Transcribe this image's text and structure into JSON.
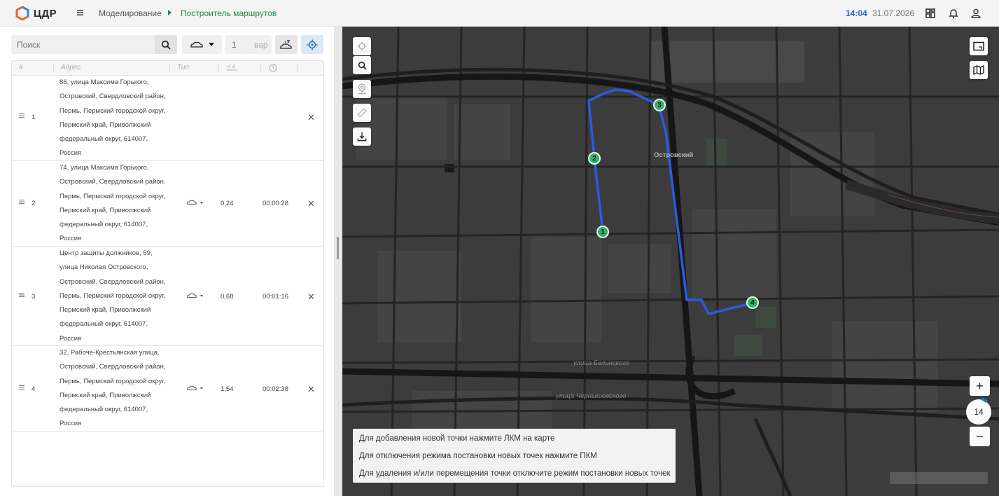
{
  "app": {
    "logo_text": "ЦДР",
    "breadcrumb": [
      "Моделирование",
      "Построитель маршрутов"
    ],
    "time": "14:04",
    "date": "31.07.2026"
  },
  "toolbar": {
    "search_placeholder": "Поиск",
    "variants_value": "1",
    "variants_unit": "вар"
  },
  "table": {
    "headers": {
      "num": "#",
      "address": "Адрес",
      "type": "Тип"
    },
    "rows": [
      {
        "num": "1",
        "address": [
          "86, улица Максима Горького,",
          "Островский, Свердловский район,",
          "Пермь, Пермский городской округ,",
          "Пермский край, Приволжский",
          "федеральный округ, 614007,",
          "Россия"
        ],
        "distance": "",
        "duration": ""
      },
      {
        "num": "2",
        "address": [
          "74, улица Максима Горького,",
          "Островский, Свердловский район,",
          "Пермь, Пермский городской округ,",
          "Пермский край, Приволжский",
          "федеральный округ, 614007,",
          "Россия"
        ],
        "distance": "0,24",
        "duration": "00:00:28"
      },
      {
        "num": "3",
        "address": [
          "Центр защиты должников, 59,",
          "улица Николая Островского,",
          "Островский, Свердловский район,",
          "Пермь, Пермский городской округ,",
          "Пермский край, Приволжский",
          "федеральный округ, 614007,",
          "Россия"
        ],
        "distance": "0,68",
        "duration": "00:01:16"
      },
      {
        "num": "4",
        "address": [
          "32, Рабоче-Крестьянская улица,",
          "Островский, Свердловский район,",
          "Пермь, Пермский городской округ,",
          "Пермский край, Приволжский",
          "федеральный округ, 614007,",
          "Россия"
        ],
        "distance": "1,54",
        "duration": "00:02:38"
      }
    ]
  },
  "map": {
    "points": [
      "1",
      "2",
      "3",
      "4"
    ],
    "labels": {
      "district": "Островский",
      "street1": "улица Белинского",
      "street2": "улица Чернышевского"
    },
    "hints": [
      "Для добавления новой точки нажмите ЛКМ на карте",
      "Для отключения режима постановки новых точек нажмите ПКМ",
      "Для удаления и/или перемещения точки отключите режим постановки новых точек"
    ],
    "zoom_level": "14",
    "route_color": "#2a5be0",
    "point_color": "#30b36a"
  },
  "icons": [
    "menu-icon",
    "bell-icon",
    "user-icon",
    "dashboard-icon",
    "search-icon",
    "car-icon",
    "crosshair-icon",
    "ruler-icon",
    "download-icon",
    "layers-icon",
    "map-icon"
  ]
}
